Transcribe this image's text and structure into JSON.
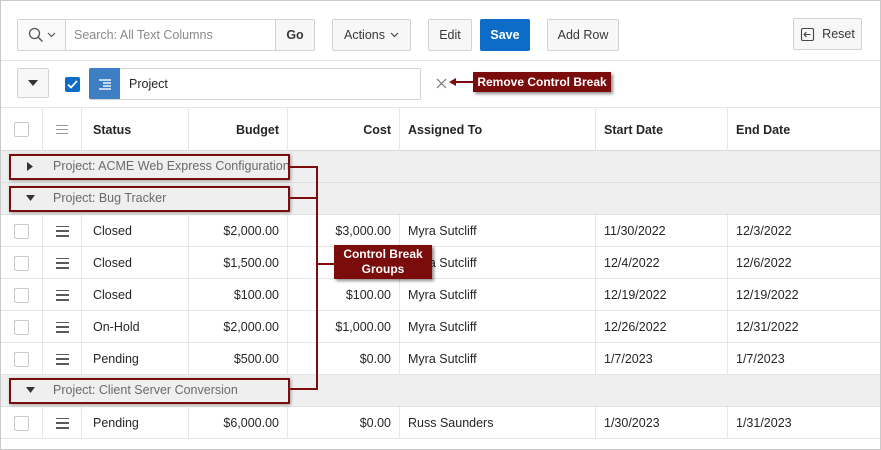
{
  "toolbar": {
    "search_placeholder": "Search: All Text Columns",
    "go_label": "Go",
    "actions_label": "Actions",
    "edit_label": "Edit",
    "save_label": "Save",
    "add_row_label": "Add Row",
    "reset_label": "Reset"
  },
  "control_break": {
    "column_label": "Project",
    "checked": true
  },
  "annotations": {
    "remove_control_break": "Remove Control Break",
    "control_break_groups_line1": "Control Break",
    "control_break_groups_line2": "Groups"
  },
  "columns": {
    "status": "Status",
    "budget": "Budget",
    "cost": "Cost",
    "assigned_to": "Assigned To",
    "start_date": "Start Date",
    "end_date": "End Date"
  },
  "groups": [
    {
      "label": "Project: ACME Web Express Configuration",
      "expanded": false,
      "rows": []
    },
    {
      "label": "Project: Bug Tracker",
      "expanded": true,
      "rows": [
        {
          "status": "Closed",
          "budget": "$2,000.00",
          "cost": "$3,000.00",
          "assigned_to": "Myra Sutcliff",
          "start_date": "11/30/2022",
          "end_date": "12/3/2022"
        },
        {
          "status": "Closed",
          "budget": "$1,500.00",
          "cost": "$1,000.00",
          "assigned_to": "Myra Sutcliff",
          "start_date": "12/4/2022",
          "end_date": "12/6/2022"
        },
        {
          "status": "Closed",
          "budget": "$100.00",
          "cost": "$100.00",
          "assigned_to": "Myra Sutcliff",
          "start_date": "12/19/2022",
          "end_date": "12/19/2022"
        },
        {
          "status": "On-Hold",
          "budget": "$2,000.00",
          "cost": "$1,000.00",
          "assigned_to": "Myra Sutcliff",
          "start_date": "12/26/2022",
          "end_date": "12/31/2022"
        },
        {
          "status": "Pending",
          "budget": "$500.00",
          "cost": "$0.00",
          "assigned_to": "Myra Sutcliff",
          "start_date": "1/7/2023",
          "end_date": "1/7/2023"
        }
      ]
    },
    {
      "label": "Project: Client Server Conversion",
      "expanded": true,
      "rows": [
        {
          "status": "Pending",
          "budget": "$6,000.00",
          "cost": "$0.00",
          "assigned_to": "Russ Saunders",
          "start_date": "1/30/2023",
          "end_date": "1/31/2023"
        }
      ]
    }
  ],
  "colors": {
    "accent": "#0c6cc8",
    "callout": "#7b0c0c",
    "group_band": "#efefef"
  }
}
